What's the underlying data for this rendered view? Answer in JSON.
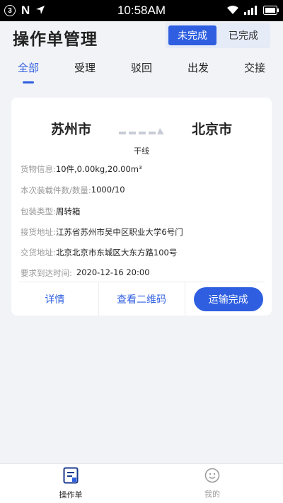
{
  "status_bar": {
    "badge": "3",
    "n_label": "N",
    "time": "10:58AM"
  },
  "header": {
    "title": "操作单管理",
    "segments": [
      {
        "label": "未完成",
        "active": true
      },
      {
        "label": "已完成",
        "active": false
      }
    ]
  },
  "tabs": [
    {
      "label": "全部",
      "active": true
    },
    {
      "label": "受理",
      "active": false
    },
    {
      "label": "驳回",
      "active": false
    },
    {
      "label": "出发",
      "active": false
    },
    {
      "label": "交接",
      "active": false
    }
  ],
  "order": {
    "from_city": "苏州市",
    "to_city": "北京市",
    "route_type": "干线",
    "fields": [
      {
        "label": "货物信息:",
        "value": "10件,0.00kg,20.00m³"
      },
      {
        "label": "本次装载件数/数量:",
        "value": "1000/10"
      },
      {
        "label": "包装类型:",
        "value": "周转箱"
      },
      {
        "label": "接货地址:",
        "value": "江苏省苏州市吴中区职业大学6号门"
      },
      {
        "label": "交货地址:",
        "value": "北京北京市东城区大东方路100号"
      },
      {
        "label": "要求到达时间:",
        "value": "2020-12-16 20:00"
      }
    ],
    "actions": {
      "details": "详情",
      "qr_code": "查看二维码",
      "complete": "运输完成"
    }
  },
  "bottom_nav": [
    {
      "label": "操作单",
      "icon": "clipboard-icon",
      "active": true
    },
    {
      "label": "我的",
      "icon": "smiley-icon",
      "active": false
    }
  ],
  "colors": {
    "accent": "#2f5fe0",
    "background": "#f2f3f7",
    "label_gray": "#999999"
  }
}
